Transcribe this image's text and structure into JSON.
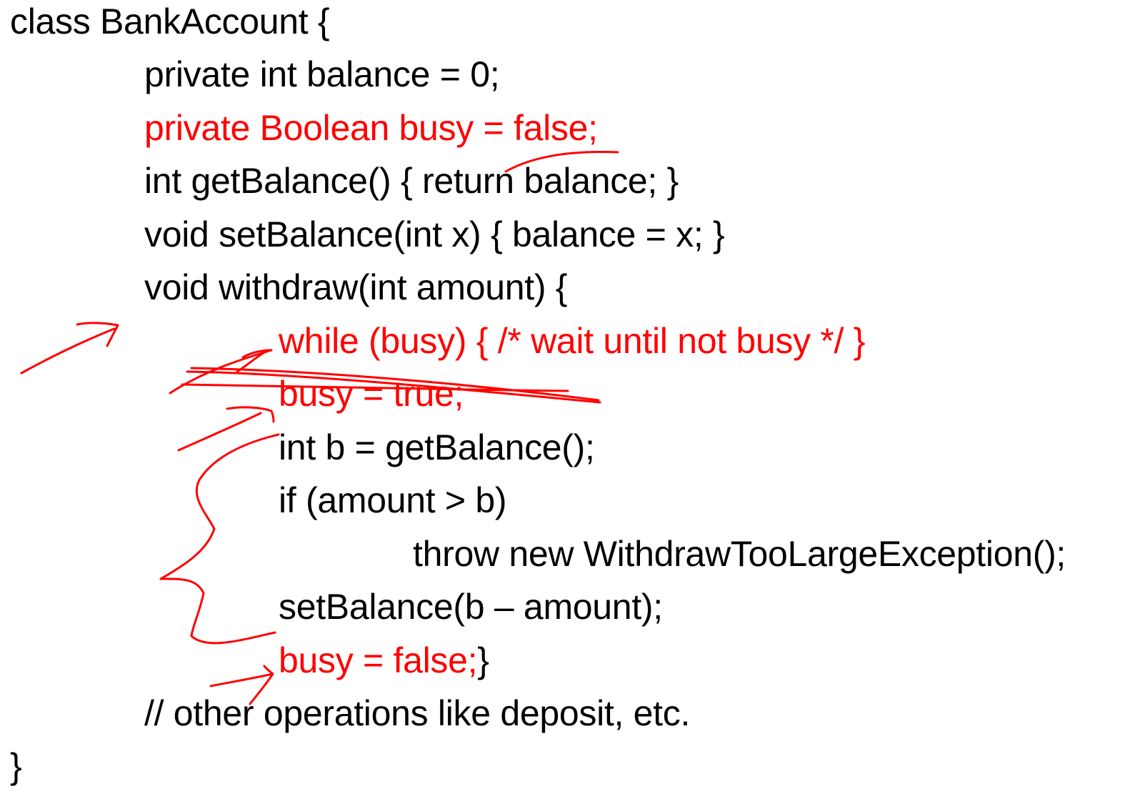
{
  "code": {
    "class_open": "class BankAccount {",
    "field_balance": "private int balance = 0;",
    "field_busy": "private Boolean busy = false;",
    "get_balance": "int getBalance() { return balance; }",
    "set_balance": "void setBalance(int x) { balance = x; }",
    "withdraw_open": "void withdraw(int amount) {",
    "while_busy": "while (busy) { /* wait until not busy */ }",
    "busy_true": "busy = true;",
    "int_b": "int b = getBalance();",
    "if_amount": "if (amount > b)",
    "throw_line": "throw new WithdrawTooLargeException();",
    "set_balance_call": "setBalance(b – amount);",
    "busy_false": "busy = false;",
    "withdraw_close": "}",
    "comment_other": "// other operations like deposit, etc.",
    "class_close": "}"
  },
  "colors": {
    "text": "#000000",
    "highlight": "#ff0000"
  }
}
